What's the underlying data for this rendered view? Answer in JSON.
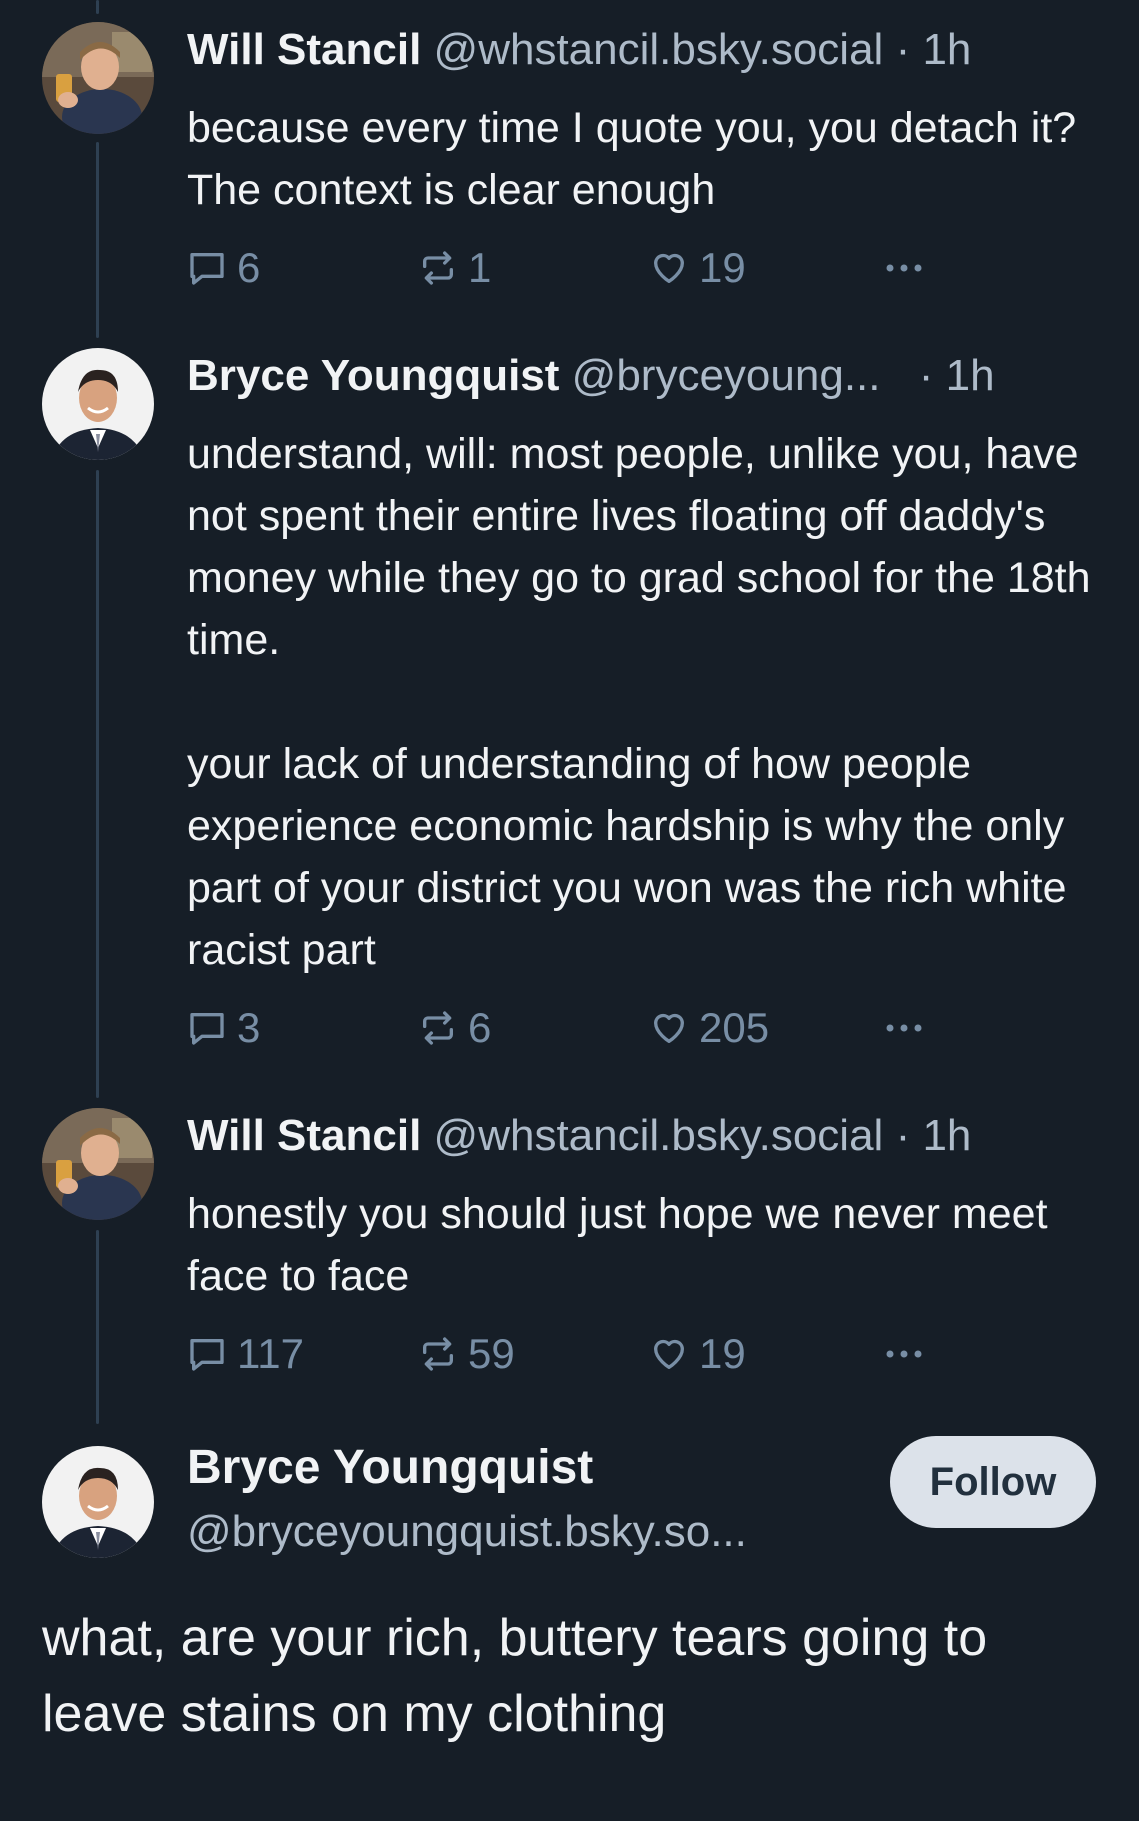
{
  "colors": {
    "background": "#161e27",
    "text_primary": "#f1f3f5",
    "text_secondary": "#aebbc9",
    "action_icon": "#788ea5",
    "thread_line": "#2e4052",
    "follow_button_bg": "#dce2ea"
  },
  "posts": [
    {
      "author_name": "Will Stancil",
      "handle": "@whstancil.bsky.social",
      "separator": "·",
      "time": "1h",
      "text": "because every time I quote you, you detach it? The context is clear enough",
      "replies": "6",
      "reposts": "1",
      "likes": "19",
      "more_icon": "ellipsis-icon"
    },
    {
      "author_name": "Bryce Youngquist",
      "handle": "@bryceyoung...",
      "separator": "·",
      "time": "1h",
      "text": "understand, will: most people, unlike you, have not spent their entire lives floating off daddy's money while they go to grad school for the 18th time.\n\nyour lack of understanding of how people experience economic hardship is why the only part of your district you won was the rich white racist part",
      "replies": "3",
      "reposts": "6",
      "likes": "205",
      "more_icon": "ellipsis-icon"
    },
    {
      "author_name": "Will Stancil",
      "handle": "@whstancil.bsky.social",
      "separator": "·",
      "time": "1h",
      "text": "honestly you should just hope we never meet face to face",
      "replies": "117",
      "reposts": "59",
      "likes": "19",
      "more_icon": "ellipsis-icon"
    }
  ],
  "focused_post": {
    "author_name": "Bryce Youngquist",
    "handle": "@bryceyoungquist.bsky.so...",
    "follow_label": "Follow",
    "text": "what, are your rich, buttery tears going to leave stains on my clothing"
  }
}
